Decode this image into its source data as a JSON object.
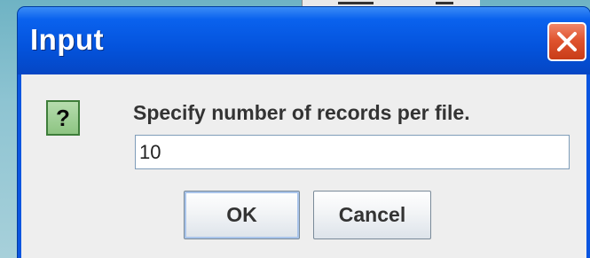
{
  "window": {
    "title": "Input"
  },
  "dialog": {
    "message": "Specify number of records per file.",
    "icon": "question-icon",
    "icon_glyph": "?",
    "input_value": "10",
    "ok_label": "OK",
    "cancel_label": "Cancel"
  },
  "colors": {
    "titlebar": "#0453dc",
    "close_button": "#e0542f",
    "dialog_body": "#eeeeee",
    "question_icon_bg": "#8dc482"
  }
}
